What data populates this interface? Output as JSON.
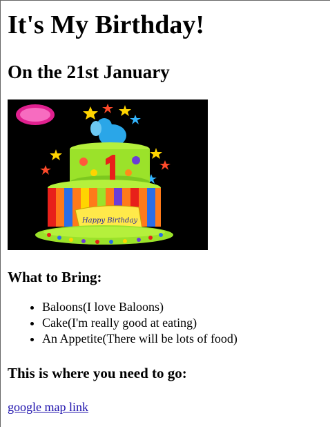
{
  "page": {
    "heading": "It's My Birthday!",
    "date_heading": "On the 21st January",
    "image_alt": "Birthday cake"
  },
  "bring": {
    "heading": "What to Bring:",
    "items": [
      "Baloons(I love Baloons)",
      "Cake(I'm really good at eating)",
      "An Appetite(There will be lots of food)"
    ]
  },
  "location": {
    "heading": "This is where you need to go:",
    "link_label": "google map link"
  },
  "colors": {
    "link": "#1a0dab",
    "cake_green": "#9be22a",
    "image_bg": "#000000"
  }
}
